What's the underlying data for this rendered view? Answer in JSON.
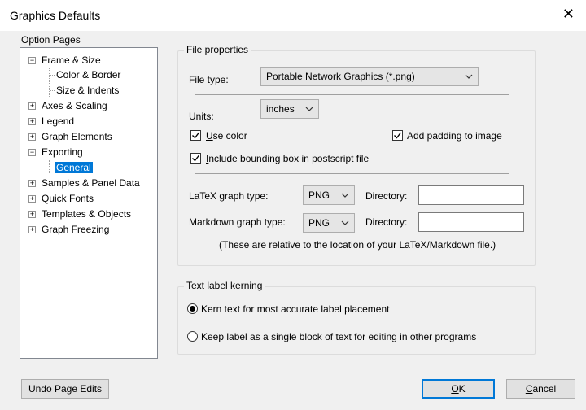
{
  "window": {
    "title": "Graphics Defaults",
    "close_glyph": "✕"
  },
  "left": {
    "header": "Option Pages",
    "tree": [
      {
        "label": "Frame & Size",
        "expander": "−"
      },
      {
        "label": "Color & Border"
      },
      {
        "label": "Size & Indents"
      },
      {
        "label": "Axes & Scaling",
        "expander": "+"
      },
      {
        "label": "Legend",
        "expander": "+"
      },
      {
        "label": "Graph Elements",
        "expander": "+"
      },
      {
        "label": "Exporting",
        "expander": "−"
      },
      {
        "label": "General",
        "selected": true
      },
      {
        "label": "Samples & Panel Data",
        "expander": "+"
      },
      {
        "label": "Quick Fonts",
        "expander": "+"
      },
      {
        "label": "Templates & Objects",
        "expander": "+"
      },
      {
        "label": "Graph Freezing",
        "expander": "+"
      }
    ]
  },
  "file_props": {
    "title": "File properties",
    "file_type_label": "File type:",
    "file_type_value": "Portable Network Graphics (*.png)",
    "units_label": "Units:",
    "units_value": "inches",
    "use_color_pre": "",
    "use_color_u": "U",
    "use_color_post": "se color",
    "use_color_checked": true,
    "add_padding_label": "Add padding to image",
    "add_padding_checked": true,
    "include_bbox_pre": "",
    "include_bbox_u": "I",
    "include_bbox_post": "nclude bounding box in postscript file",
    "include_bbox_checked": true,
    "latex_label": "LaTeX graph type:",
    "latex_value": "PNG",
    "markdown_label": "Markdown graph type:",
    "markdown_value": "PNG",
    "directory_label": "Directory:",
    "note": "(These are relative to the location of your LaTeX/Markdown file.)"
  },
  "kerning": {
    "title": "Text label kerning",
    "option1": "Kern text for most accurate label placement",
    "option2": "Keep label as a single block of text for editing in other programs",
    "selected": 1
  },
  "buttons": {
    "undo": "Undo Page Edits",
    "ok_u": "O",
    "ok_rest": "K",
    "cancel_u": "C",
    "cancel_rest": "ancel"
  },
  "icons": {
    "check": "check-icon",
    "chevron": "chevron-down-icon",
    "close": "close-icon"
  }
}
